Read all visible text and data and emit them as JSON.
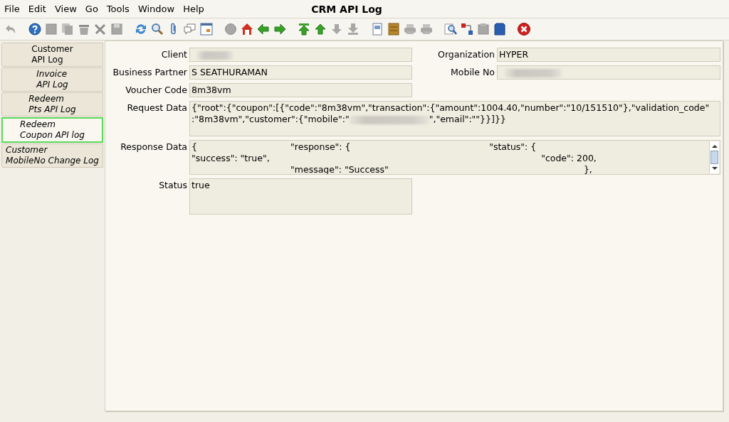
{
  "menu": [
    {
      "label": "File"
    },
    {
      "label": "Edit"
    },
    {
      "label": "View"
    },
    {
      "label": "Go"
    },
    {
      "label": "Tools"
    },
    {
      "label": "Window"
    },
    {
      "label": "Help"
    }
  ],
  "window": {
    "title": "CRM API Log"
  },
  "toolbar": [
    {
      "kind": "undo",
      "disabled": true,
      "gap": true
    },
    {
      "kind": "help",
      "disabled": false
    },
    {
      "kind": "new",
      "disabled": true
    },
    {
      "kind": "copy",
      "disabled": true
    },
    {
      "kind": "delete",
      "disabled": true
    },
    {
      "kind": "tools",
      "disabled": true
    },
    {
      "kind": "save",
      "disabled": true,
      "gap": true
    },
    {
      "kind": "refresh",
      "disabled": false
    },
    {
      "kind": "find",
      "disabled": false
    },
    {
      "kind": "attach",
      "disabled": false
    },
    {
      "kind": "chat",
      "disabled": false
    },
    {
      "kind": "grid",
      "disabled": false,
      "gap": true
    },
    {
      "kind": "history",
      "disabled": true
    },
    {
      "kind": "home",
      "disabled": false
    },
    {
      "kind": "back",
      "disabled": false
    },
    {
      "kind": "forward",
      "disabled": false,
      "gap": true
    },
    {
      "kind": "first",
      "disabled": false
    },
    {
      "kind": "previous",
      "disabled": false
    },
    {
      "kind": "next",
      "disabled": true
    },
    {
      "kind": "last",
      "disabled": true,
      "gap": true
    },
    {
      "kind": "report",
      "disabled": false
    },
    {
      "kind": "archive",
      "disabled": false
    },
    {
      "kind": "print",
      "disabled": true
    },
    {
      "kind": "print",
      "disabled": true,
      "gap": true
    },
    {
      "kind": "zoom",
      "disabled": false
    },
    {
      "kind": "workflow",
      "disabled": false
    },
    {
      "kind": "product",
      "disabled": true
    },
    {
      "kind": "card",
      "disabled": false,
      "gap": true
    },
    {
      "kind": "exit",
      "disabled": false
    }
  ],
  "tabs": [
    {
      "label": "Customer\nAPI Log",
      "kind": "main",
      "selected": false
    },
    {
      "label": "Invoice\nAPI Log",
      "kind": "detail",
      "selected": false
    },
    {
      "label": "Redeem\nPts API Log",
      "kind": "detail",
      "selected": false
    },
    {
      "label": "Redeem\nCoupon API log",
      "kind": "detail",
      "selected": true
    },
    {
      "label": "Customer\nMobileNo Change Log",
      "kind": "detail",
      "selected": false
    }
  ],
  "fields": [
    {
      "label": "Client",
      "kind": "short",
      "redacted": true
    },
    {
      "label": "Organization",
      "kind": "short",
      "value": "HYPER"
    },
    {
      "label": "Business Partner",
      "kind": "short",
      "value": "S SEATHURAMAN"
    },
    {
      "label": "Mobile No",
      "kind": "short",
      "redacted": true
    },
    {
      "label": "Voucher Code",
      "kind": "short",
      "value": "8m38vm"
    },
    {
      "label": "Request Data",
      "kind": "wide",
      "segments": [
        {
          "kind": "text",
          "text": "{\"root\":{\"coupon\":[{\"code\":\"8m38vm\",\"transaction\":{\"amount\":1004.40,\"number\":\"10/151510\"},\"validation_code\"\n:\"8m38vm\",\"customer\":{\"mobile\":\""
        },
        {
          "kind": "redacted"
        },
        {
          "kind": "text",
          "text": "\",\"email\":\"\"}}]}}"
        }
      ]
    },
    {
      "label": "Response Data",
      "kind": "scroll",
      "value": "{                                 \"response\": {                                                 \"status\": {\n\"success\": \"true\",                                                                                                \"code\": 200,\n                                   \"message\": \"Success\"                                                                     },"
    },
    {
      "label": "Status",
      "kind": "area",
      "value": "true"
    }
  ]
}
